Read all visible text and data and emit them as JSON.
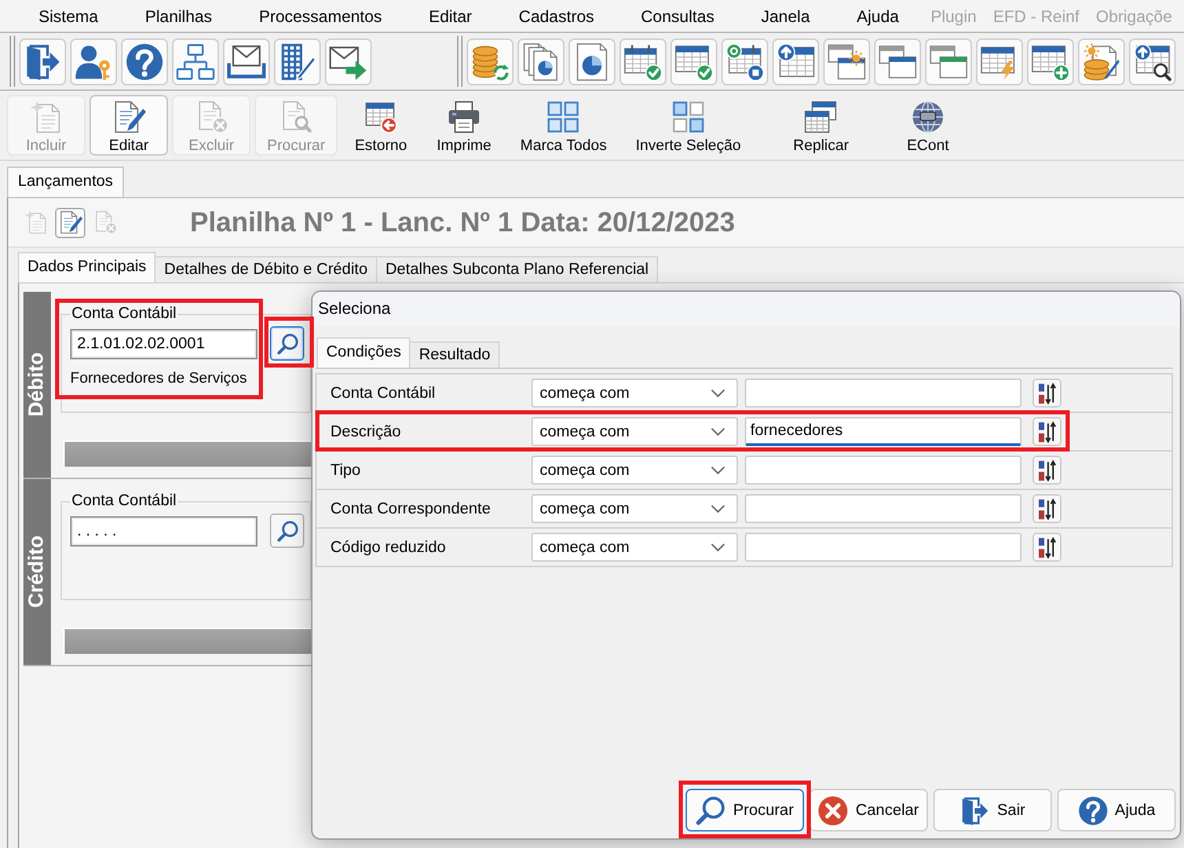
{
  "menu_bar": {
    "items": [
      {
        "label": "Sistema",
        "disabled": false
      },
      {
        "label": "Planilhas",
        "disabled": false
      },
      {
        "label": "Processamentos",
        "disabled": false
      },
      {
        "label": "Editar",
        "disabled": false
      },
      {
        "label": "Cadastros",
        "disabled": false
      },
      {
        "label": "Consultas",
        "disabled": false
      },
      {
        "label": "Janela",
        "disabled": false
      },
      {
        "label": "Ajuda",
        "disabled": false
      },
      {
        "label": "Plugin",
        "disabled": true
      },
      {
        "label": "EFD - Reinf",
        "disabled": true
      },
      {
        "label": "Obrigaçõe",
        "disabled": true
      }
    ]
  },
  "action_toolbar": {
    "buttons": [
      {
        "kind": "new",
        "label": "Incluir",
        "disabled": true,
        "pressed": false
      },
      {
        "kind": "edit",
        "label": "Editar",
        "disabled": false,
        "pressed": true
      },
      {
        "kind": "delete",
        "label": "Excluir",
        "disabled": true,
        "pressed": false
      },
      {
        "kind": "find",
        "label": "Procurar",
        "disabled": true,
        "pressed": false
      },
      {
        "kind": "reverse",
        "label": "Estorno",
        "disabled": false,
        "pressed": false
      },
      {
        "kind": "print",
        "label": "Imprime",
        "disabled": false,
        "pressed": false
      },
      {
        "kind": "mark-all",
        "label": "Marca Todos",
        "disabled": false,
        "pressed": false
      },
      {
        "kind": "invert",
        "label": "Inverte Seleção",
        "disabled": false,
        "pressed": false
      },
      {
        "kind": "replicate",
        "label": "Replicar",
        "disabled": false,
        "pressed": false
      },
      {
        "kind": "econt",
        "label": "ECont",
        "disabled": false,
        "pressed": false
      }
    ]
  },
  "document_tabs": [
    {
      "label": "Lançamentos",
      "selected": true
    }
  ],
  "record_toolbar": {
    "buttons": [
      {
        "kind": "new",
        "disabled": true,
        "pressed": false
      },
      {
        "kind": "edit",
        "disabled": false,
        "pressed": true
      },
      {
        "kind": "delete",
        "disabled": true,
        "pressed": false
      }
    ]
  },
  "record_title": "Planilha Nº 1 - Lanc. Nº 1 Data: 20/12/2023",
  "detail_tabs": [
    {
      "label": "Dados Principais",
      "selected": true
    },
    {
      "label": "Detalhes de Débito e Crédito",
      "selected": false
    },
    {
      "label": "Detalhes Subconta Plano Referencial",
      "selected": false
    }
  ],
  "sections": [
    {
      "title": "Débito",
      "account_group": {
        "label": "Conta Contábil",
        "value": "2.1.01.02.02.0001",
        "description": "Fornecedores de Serviços",
        "highlighted": true
      },
      "search_button": {
        "focused": true,
        "highlighted": true
      }
    },
    {
      "title": "Crédito",
      "account_group": {
        "label": "Conta Contábil",
        "value": ". . . . .",
        "highlighted": false
      },
      "search_button": {
        "focused": false,
        "highlighted": false
      }
    }
  ],
  "dialog": {
    "title": "Seleciona",
    "tabs": [
      {
        "label": "Condições",
        "selected": true
      },
      {
        "label": "Resultado",
        "selected": false
      }
    ],
    "conditions": [
      {
        "field": "Conta Contábil",
        "operator": "começa com",
        "focused": false,
        "highlighted": false
      },
      {
        "field": "Descrição",
        "operator": "começa com",
        "value": "fornecedores",
        "focused": true,
        "highlighted": true
      },
      {
        "field": "Tipo",
        "operator": "começa com",
        "focused": false,
        "highlighted": false
      },
      {
        "field": "Conta Correspondente",
        "operator": "começa com",
        "focused": false,
        "highlighted": false
      },
      {
        "field": "Código reduzido",
        "operator": "começa com",
        "focused": false,
        "highlighted": false
      }
    ],
    "buttons": [
      {
        "kind": "search",
        "label": "Procurar",
        "default": true,
        "highlighted": true
      },
      {
        "kind": "cancel",
        "label": "Cancelar",
        "default": false,
        "highlighted": false
      },
      {
        "kind": "exit",
        "label": "Sair",
        "default": false,
        "highlighted": false
      },
      {
        "kind": "help",
        "label": "Ajuda",
        "default": false,
        "highlighted": false
      }
    ]
  }
}
